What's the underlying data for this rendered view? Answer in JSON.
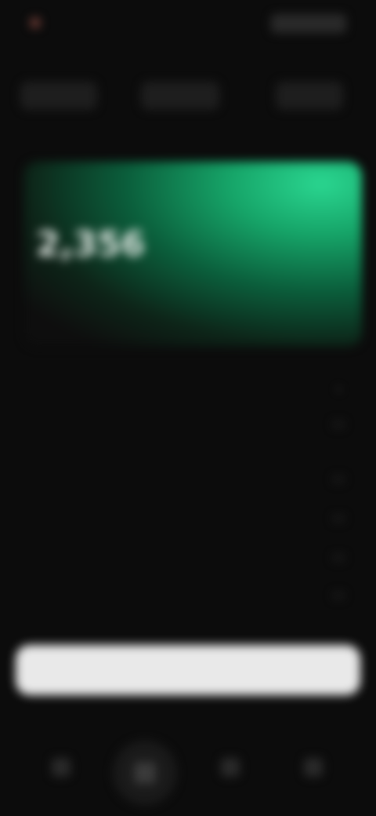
{
  "top": {
    "brand": "",
    "right_label": ""
  },
  "tabs": [
    {
      "label": ""
    },
    {
      "label": ""
    },
    {
      "label": ""
    }
  ],
  "hero": {
    "label": "",
    "amount": "2,356",
    "unit": "",
    "subtitle": ""
  },
  "details": {
    "title": "",
    "rows": [
      {
        "key": "",
        "value": ""
      },
      {
        "key": "",
        "value": ""
      },
      {
        "key": "",
        "value": ""
      },
      {
        "key": "",
        "value": ""
      },
      {
        "key": "",
        "value": ""
      }
    ]
  },
  "cta": {
    "label": ""
  },
  "colors": {
    "accent": "#1fc081",
    "background": "#0c0c0c",
    "button": "#e9e9e9"
  },
  "bottom_nav": {
    "icons": [
      "home-icon",
      "center-action-icon",
      "wallet-icon",
      "profile-icon"
    ]
  }
}
